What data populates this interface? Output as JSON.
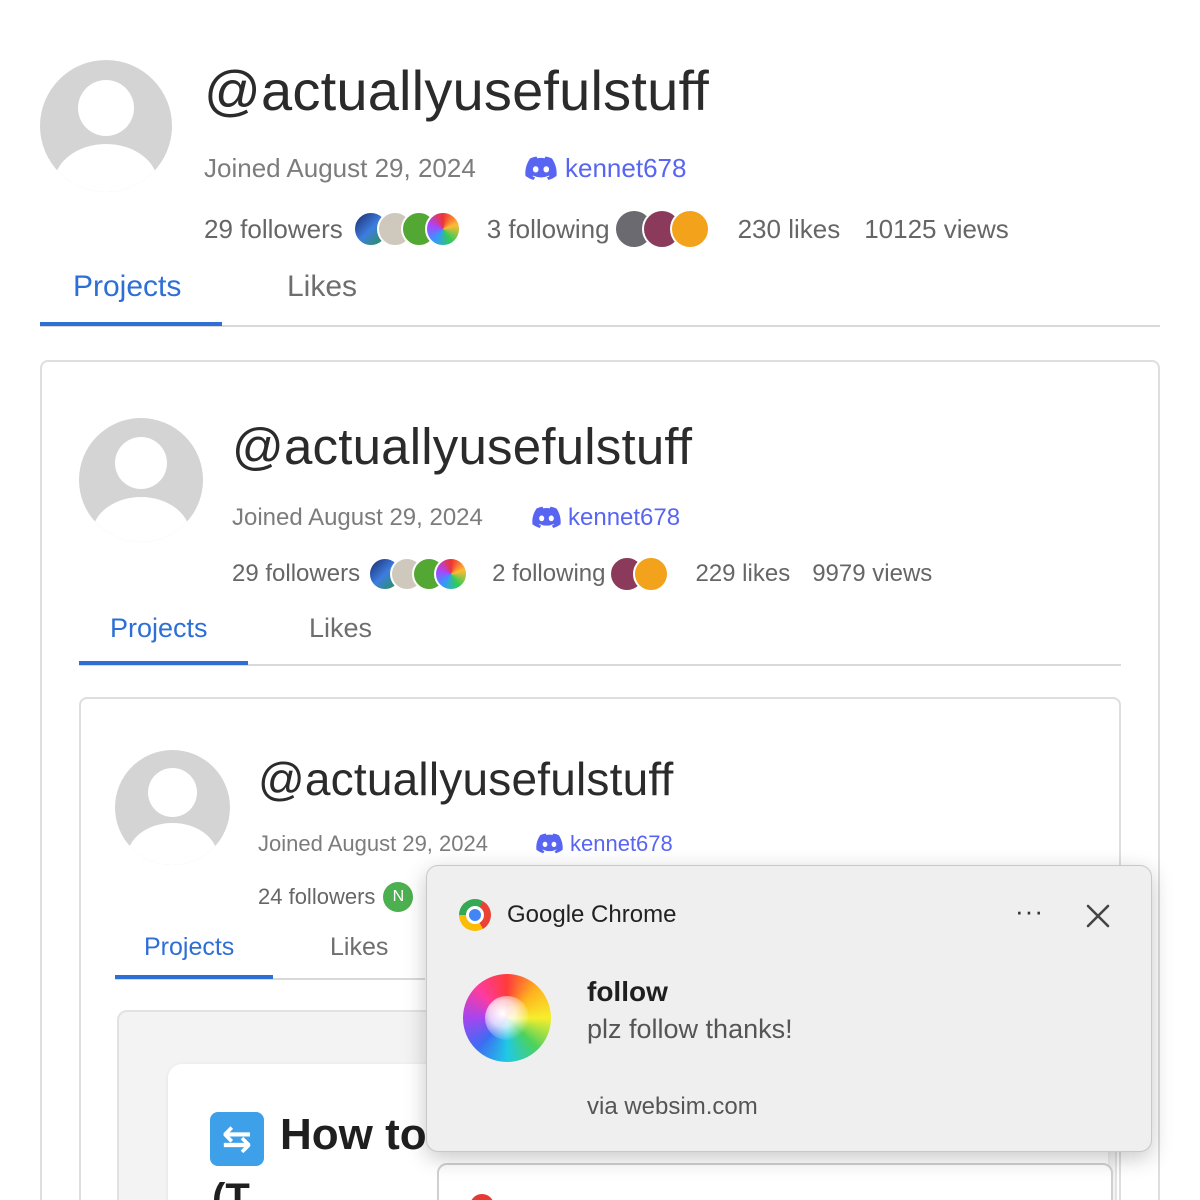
{
  "level1": {
    "handle": "@actuallyusefulstuff",
    "joined": "Joined August 29, 2024",
    "discord": "kennet678",
    "followers": "29 followers",
    "following": "3 following",
    "likes": "230 likes",
    "views": "10125 views",
    "tabs": [
      "Projects",
      "Likes"
    ]
  },
  "level2": {
    "handle": "@actuallyusefulstuff",
    "joined": "Joined August 29, 2024",
    "discord": "kennet678",
    "followers": "29 followers",
    "following": "2 following",
    "likes": "229 likes",
    "views": "9979 views",
    "tabs": [
      "Projects",
      "Likes"
    ]
  },
  "level3": {
    "handle": "@actuallyusefulstuff",
    "joined": "Joined August 29, 2024",
    "discord": "kennet678",
    "followers": "24 followers",
    "follower_badge": "N",
    "tabs": [
      "Projects",
      "Likes"
    ],
    "project_title": "How to Get Connect 3.0 Back",
    "project_title_cont": "(T"
  },
  "notification": {
    "app": "Google Chrome",
    "more": "···",
    "title": "follow",
    "message": "plz follow thanks!",
    "via": "via websim.com"
  },
  "colors": {
    "accent": "#2e6fd6",
    "discord": "#5865f2",
    "avatar_gray": "#d4d4d4"
  },
  "icons": [
    "default-avatar-icon",
    "discord-icon",
    "chrome-icon",
    "more-icon",
    "close-icon",
    "swirl-icon",
    "repeat-icon"
  ]
}
